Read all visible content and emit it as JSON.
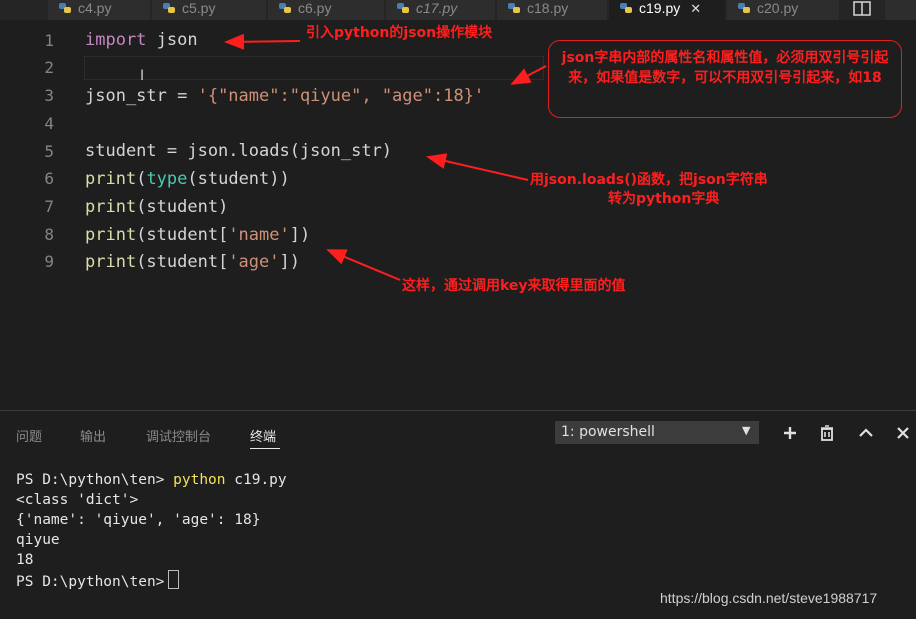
{
  "tabs": [
    {
      "label": "c4.py"
    },
    {
      "label": "c5.py"
    },
    {
      "label": "c6.py"
    },
    {
      "label": "c17.py"
    },
    {
      "label": "c18.py"
    },
    {
      "label": "c19.py",
      "active": true,
      "close": "✕"
    },
    {
      "label": "c20.py"
    }
  ],
  "editor": {
    "line_numbers": [
      "1",
      "2",
      "3",
      "4",
      "5",
      "6",
      "7",
      "8",
      "9"
    ],
    "code": {
      "l1_kw": "import",
      "l1_rest": " json",
      "l3_a": "json_str = ",
      "l3_str": "'{\"name\":\"qiyue\", \"age\":18}'",
      "l5": "student = json.loads(json_str)",
      "l6_fn": "print",
      "l6_a": "(",
      "l6_bi": "type",
      "l6_b": "(student))",
      "l7_fn": "print",
      "l7_a": "(student)",
      "l8_fn": "print",
      "l8_a": "(student[",
      "l8_str": "'name'",
      "l8_b": "])",
      "l9_fn": "print",
      "l9_a": "(student[",
      "l9_str": "'age'",
      "l9_b": "])",
      "cursor_glyph": "I"
    }
  },
  "annotations": {
    "import_note": "引入python的json操作模块",
    "box_note": "json字串内部的属性名和属性值，必须用双引号引起来，如果值是数字，可以不用双引号引起来，如18",
    "loads_note_1": "用json.loads()函数，把json字符串",
    "loads_note_2": "转为python字典",
    "key_note": "这样，通过调用key来取得里面的值",
    "color": "#ff1e1e"
  },
  "panel": {
    "tabs": [
      "问题",
      "输出",
      "调试控制台",
      "终端"
    ],
    "active_tab": "终端",
    "terminal_select": "1: powershell",
    "select_arrow": "▼"
  },
  "terminal": {
    "prompt1": "PS D:\\python\\ten> ",
    "cmd1": "python",
    "cmd1_rest": " c19.py",
    "out1": "<class 'dict'>",
    "out2": "{'name': 'qiyue', 'age': 18}",
    "out3": "qiyue",
    "out4": "18",
    "prompt2": "PS D:\\python\\ten>"
  },
  "watermark": "https://blog.csdn.net/steve1988717",
  "colors": {
    "editor_bg": "#1e1e1e",
    "keyword": "#c586c0",
    "function": "#dcdcaa",
    "builtin": "#4ec9b0",
    "string": "#ce9178",
    "command": "#f3e35a"
  }
}
